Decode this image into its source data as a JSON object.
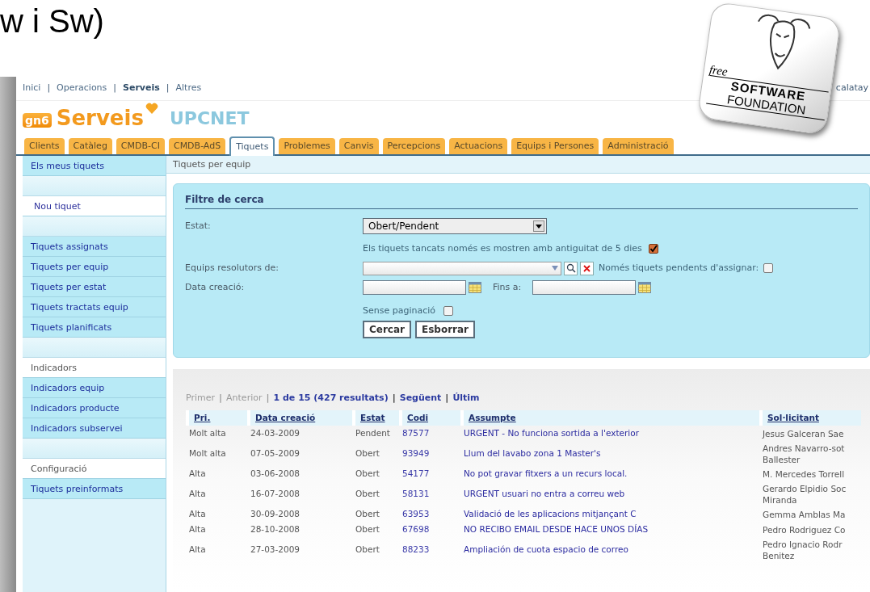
{
  "slide_title": "w i Sw)",
  "logo": {
    "free": "free",
    "line1": "SOFTWARE",
    "line2": "FOUNDATION"
  },
  "top_nav": [
    {
      "label": "Inici",
      "selected": false
    },
    {
      "sep": "|",
      "label": "Operacions",
      "selected": false
    },
    {
      "sep": "|",
      "label": "Serveis",
      "selected": true
    },
    {
      "sep": "|",
      "label": "Altres",
      "selected": false
    }
  ],
  "user": "calatay",
  "brand": {
    "badge": "gn6",
    "name": "Serveis",
    "org": "UPCNET"
  },
  "tabs": [
    {
      "label": "Clients",
      "selected": false
    },
    {
      "label": "Catàleg",
      "selected": false
    },
    {
      "label": "CMDB-CI",
      "selected": false
    },
    {
      "label": "CMDB-AdS",
      "selected": false
    },
    {
      "label": "Tiquets",
      "selected": true
    },
    {
      "label": "Problemes",
      "selected": false
    },
    {
      "label": "Canvis",
      "selected": false
    },
    {
      "label": "Percepcions",
      "selected": false
    },
    {
      "label": "Actuacions",
      "selected": false
    },
    {
      "label": "Equips i Persones",
      "selected": false
    },
    {
      "label": "Administració",
      "selected": false
    }
  ],
  "sidebar": {
    "sections": [
      {
        "items": [
          {
            "kind": "link",
            "label": "Els meus tiquets"
          }
        ]
      },
      {
        "items": [
          {
            "kind": "action",
            "label": "Nou tiquet"
          }
        ]
      },
      {
        "items": [
          {
            "kind": "link",
            "label": "Tiquets assignats"
          },
          {
            "kind": "link",
            "label": "Tiquets per equip"
          },
          {
            "kind": "link",
            "label": "Tiquets per estat"
          },
          {
            "kind": "link",
            "label": "Tiquets tractats equip"
          },
          {
            "kind": "link",
            "label": "Tiquets planificats"
          }
        ]
      },
      {
        "items": [
          {
            "kind": "heading",
            "label": "Indicadors"
          },
          {
            "kind": "link",
            "label": "Indicadors equip"
          },
          {
            "kind": "link",
            "label": "Indicadors producte"
          },
          {
            "kind": "link",
            "label": "Indicadors subservei"
          }
        ]
      },
      {
        "items": [
          {
            "kind": "heading",
            "label": "Configuració"
          },
          {
            "kind": "link",
            "label": "Tiquets preinformats"
          }
        ]
      }
    ]
  },
  "breadcrumb": "Tiquets per equip",
  "filter": {
    "title": "Filtre de cerca",
    "estat_label": "Estat:",
    "estat_value": "Obert/Pendent",
    "closed_note": "Els tiquets tancats només es mostren amb antiguitat de 5 dies",
    "closed_checked": true,
    "equips_label": "Equips resolutors de:",
    "unassigned_label": "Només tiquets pendents d'assignar:",
    "unassigned_checked": false,
    "date_label": "Data creació:",
    "until_label": "Fins a:",
    "nopaging_label": "Sense paginació",
    "nopaging_checked": false,
    "buttons": [
      "Cercar",
      "Esborrar"
    ]
  },
  "pager": [
    {
      "label": "Primer",
      "disabled": true,
      "sep": "|"
    },
    {
      "label": "Anterior",
      "disabled": true,
      "sep": "|"
    },
    {
      "label": "1 de 15 (427 resultats)",
      "disabled": false,
      "sep": "|"
    },
    {
      "label": "Següent",
      "disabled": false,
      "sep": "|"
    },
    {
      "label": "Últim",
      "disabled": false
    }
  ],
  "table": {
    "columns": [
      "Pri.",
      "Data creació",
      "Estat",
      "Codi",
      "Assumpte",
      "Sol·licitant"
    ],
    "rows": [
      {
        "pri": "Molt alta",
        "date": "24-03-2009",
        "estat": "Pendent",
        "codi": "87577",
        "assumpte": "URGENT - No funciona sortida a l'exterior",
        "solicitant": [
          "Jesus Galceran Sae"
        ]
      },
      {
        "pri": "Molt alta",
        "date": "07-05-2009",
        "estat": "Obert",
        "codi": "93949",
        "assumpte": "Llum del lavabo zona 1 Master's",
        "solicitant": [
          "Andres Navarro-sot",
          "Ballester"
        ]
      },
      {
        "pri": "Alta",
        "date": "03-06-2008",
        "estat": "Obert",
        "codi": "54177",
        "assumpte": "No pot gravar fitxers a un recurs local.",
        "solicitant": [
          "M. Mercedes Torrell"
        ]
      },
      {
        "pri": "Alta",
        "date": "16-07-2008",
        "estat": "Obert",
        "codi": "58131",
        "assumpte": "URGENT usuari no entra a correu web",
        "solicitant": [
          "Gerardo Elpidio Soc",
          "Miranda"
        ]
      },
      {
        "pri": "Alta",
        "date": "30-09-2008",
        "estat": "Obert",
        "codi": "63953",
        "assumpte": "Validació de les aplicacions mitjançant C",
        "solicitant": [
          "Gemma Amblas Ma"
        ]
      },
      {
        "pri": "Alta",
        "date": "28-10-2008",
        "estat": "Obert",
        "codi": "67698",
        "assumpte": "NO RECIBO EMAIL DESDE HACE UNOS DÍAS",
        "solicitant": [
          "Pedro Rodriguez Co"
        ]
      },
      {
        "pri": "Alta",
        "date": "27-03-2009",
        "estat": "Obert",
        "codi": "88233",
        "assumpte": "Ampliación de cuota espacio de correo",
        "solicitant": [
          "Pedro Ignacio Rodr",
          "Benitez"
        ]
      }
    ]
  }
}
